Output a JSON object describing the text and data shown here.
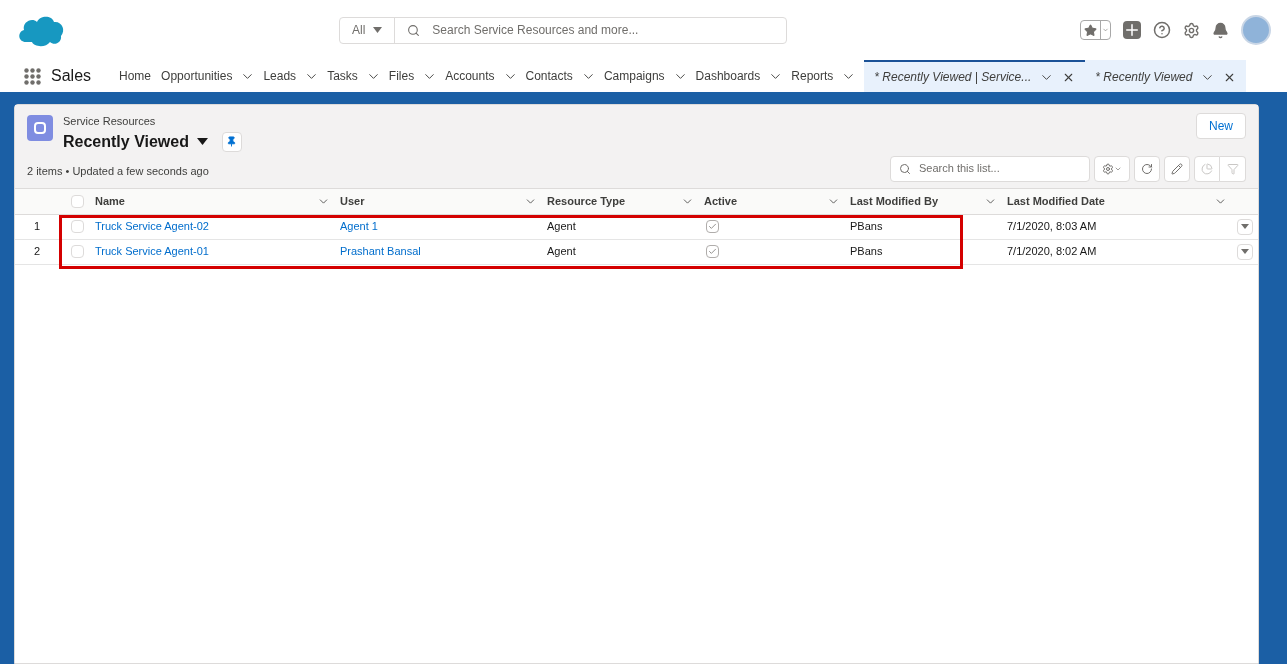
{
  "header": {
    "search_scope": "All",
    "search_placeholder": "Search Service Resources and more..."
  },
  "nav": {
    "app_name": "Sales",
    "items": [
      {
        "label": "Home",
        "dropdown": false
      },
      {
        "label": "Opportunities",
        "dropdown": true
      },
      {
        "label": "Leads",
        "dropdown": true
      },
      {
        "label": "Tasks",
        "dropdown": true
      },
      {
        "label": "Files",
        "dropdown": true
      },
      {
        "label": "Accounts",
        "dropdown": true
      },
      {
        "label": "Contacts",
        "dropdown": true
      },
      {
        "label": "Campaigns",
        "dropdown": true
      },
      {
        "label": "Dashboards",
        "dropdown": true
      },
      {
        "label": "Reports",
        "dropdown": true
      }
    ],
    "tabs": [
      {
        "label": "* Recently Viewed | Service...",
        "selected": true
      },
      {
        "label": "* Recently Viewed",
        "selected": false
      }
    ]
  },
  "list": {
    "object": "Service Resources",
    "view": "Recently Viewed",
    "status": "2 items • Updated a few seconds ago",
    "new_button": "New",
    "search_placeholder": "Search this list...",
    "all_selected": false,
    "columns": [
      "Name",
      "User",
      "Resource Type",
      "Active",
      "Last Modified By",
      "Last Modified Date"
    ],
    "rows": [
      {
        "number": "1",
        "selected": false,
        "name": "Truck Service Agent-02",
        "user": "Agent 1",
        "resource_type": "Agent",
        "active": true,
        "modified_by": "PBans",
        "modified_date": "7/1/2020, 8:03 AM"
      },
      {
        "number": "2",
        "selected": false,
        "name": "Truck Service Agent-01",
        "user": "Prashant Bansal",
        "resource_type": "Agent",
        "active": true,
        "modified_by": "PBans",
        "modified_date": "7/1/2020, 8:02 AM"
      }
    ]
  }
}
